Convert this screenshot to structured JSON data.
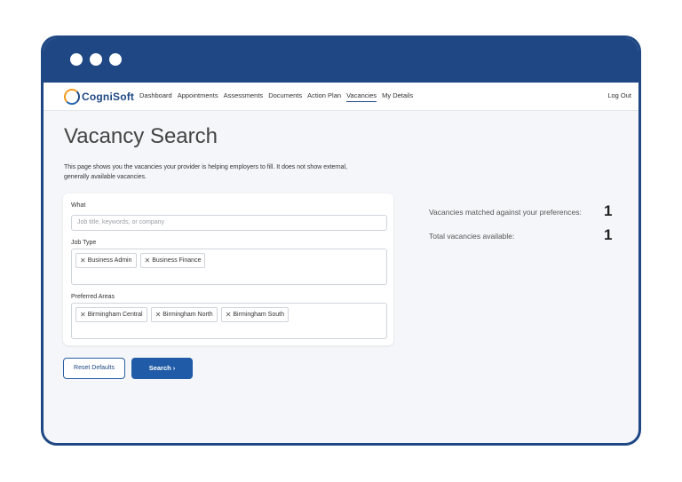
{
  "brand": {
    "name": "CogniSoft"
  },
  "nav": {
    "items": [
      {
        "label": "Dashboard"
      },
      {
        "label": "Appointments"
      },
      {
        "label": "Assessments"
      },
      {
        "label": "Documents"
      },
      {
        "label": "Action Plan"
      },
      {
        "label": "Vacancies",
        "active": true
      },
      {
        "label": "My Details"
      }
    ],
    "logout": "Log Out"
  },
  "page": {
    "title": "Vacancy Search",
    "intro": "This page shows you the vacancies your provider is helping employers to fill. It does not show external, generally available vacancies."
  },
  "form": {
    "what_label": "What",
    "what_placeholder": "Job title, keywords, or company",
    "job_type_label": "Job Type",
    "job_types": [
      "Business Admin",
      "Business Finance"
    ],
    "areas_label": "Preferred Areas",
    "areas": [
      "Birmingham Central",
      "Birmingham North",
      "Birmingham South"
    ],
    "remove_icon": "✕"
  },
  "buttons": {
    "reset": "Reset Defaults",
    "search": "Search ›"
  },
  "stats": {
    "matched_label": "Vacancies matched against your preferences:",
    "matched_value": "1",
    "total_label": "Total vacancies available:",
    "total_value": "1"
  },
  "colors": {
    "brand_navy": "#1e4784",
    "primary_button": "#1f5ba6",
    "logo_orange": "#f39a1e"
  }
}
